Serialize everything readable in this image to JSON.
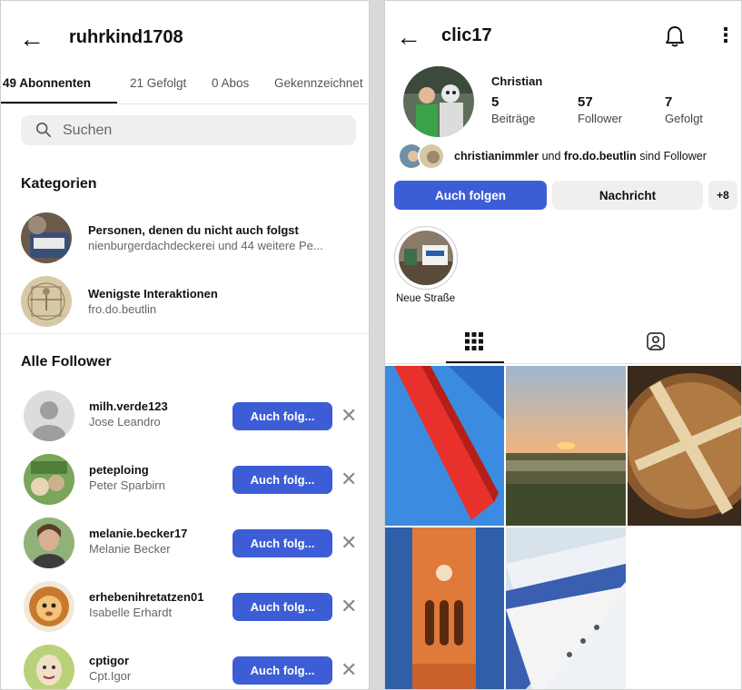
{
  "left": {
    "title": "ruhrkind1708",
    "tabs": [
      {
        "label": "49 Abonnenten"
      },
      {
        "label": "21 Gefolgt"
      },
      {
        "label": "0 Abos"
      },
      {
        "label": "Gekennzeichnet"
      }
    ],
    "search": {
      "placeholder": "Suchen"
    },
    "categories_title": "Kategorien",
    "categories": [
      {
        "title": "Personen, denen du nicht auch folgst",
        "subtitle": "nienburgerdachdeckerei und 44 weitere Pe..."
      },
      {
        "title": "Wenigste Interaktionen",
        "subtitle": "fro.do.beutlin"
      }
    ],
    "followers_title": "Alle Follower",
    "followers": [
      {
        "username": "milh.verde123",
        "name": "Jose Leandro",
        "button": "Auch folg..."
      },
      {
        "username": "peteploing",
        "name": "Peter Sparbirn",
        "button": "Auch folg..."
      },
      {
        "username": "melanie.becker17",
        "name": "Melanie Becker",
        "button": "Auch folg..."
      },
      {
        "username": "erhebenihretatzen01",
        "name": "Isabelle Erhardt",
        "button": "Auch folg..."
      },
      {
        "username": "cptigor",
        "name": "Cpt.Igor",
        "button": "Auch folg..."
      }
    ]
  },
  "right": {
    "title": "clic17",
    "display_name": "Christian",
    "stats": [
      {
        "value": "5",
        "label": "Beiträge"
      },
      {
        "value": "57",
        "label": "Follower"
      },
      {
        "value": "7",
        "label": "Gefolgt"
      }
    ],
    "mutual": {
      "user1": "christianimmler",
      "connector": " und ",
      "user2": "fro.do.beutlin",
      "suffix": " sind Follower"
    },
    "buttons": {
      "follow": "Auch folgen",
      "message": "Nachricht",
      "add_person_icon": "+8"
    },
    "highlight_label": "Neue Straße",
    "colors": {
      "accent": "#3d5dd6",
      "secondary_button": "#efefef"
    }
  }
}
